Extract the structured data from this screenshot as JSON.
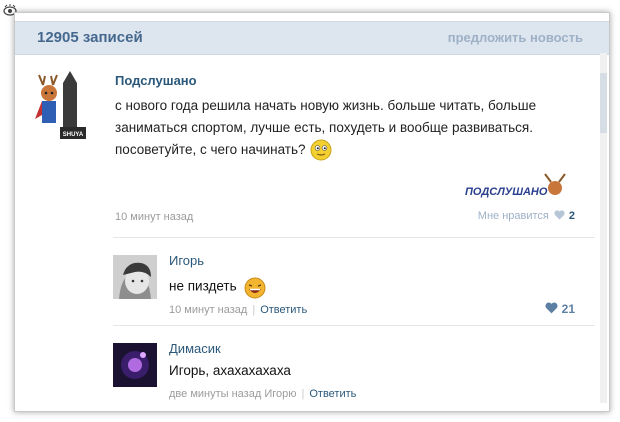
{
  "header": {
    "records_count": "12905 записей",
    "suggest_news": "предложить новость"
  },
  "post": {
    "author": "Подслушано",
    "text": "с нового года решила начать новую жизнь. больше читать, больше заниматься спортом, лучше есть, похудеть и вообще развиваться. посоветуйте, с чего начинать?",
    "time": "10 минут назад",
    "likes_label": "Мне нравится",
    "likes_count": "2",
    "avatar_badge": "SHUYA",
    "watermark": "ПОДСЛУШАНО"
  },
  "comments": [
    {
      "author": "Игорь",
      "text": "не пиздеть",
      "time": "10 минут назад",
      "reply_label": "Ответить",
      "likes": "21"
    },
    {
      "author": "Димасик",
      "text": "Игорь, ахахахахаха",
      "time": "две минуты назад",
      "reply_to": "Игорю",
      "reply_label": "Ответить"
    }
  ],
  "colors": {
    "link": "#2b587a",
    "header_bg": "#dde5ee",
    "muted": "#9b9b9b",
    "like_heart": "#5d7fa3"
  },
  "icons": [
    "eye-icon",
    "smiley-icon",
    "laughing-emoji-icon",
    "heart-icon",
    "deer-avatar",
    "boy-avatar",
    "purple-avatar"
  ]
}
